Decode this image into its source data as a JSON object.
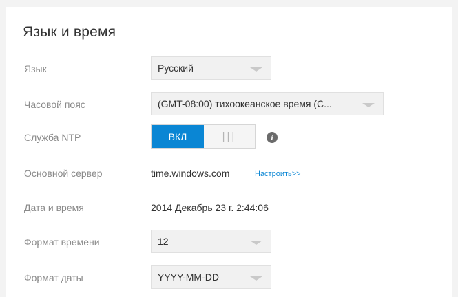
{
  "section": {
    "title": "Язык и время"
  },
  "rows": {
    "language": {
      "label": "Язык",
      "value": "Русский"
    },
    "timezone": {
      "label": "Часовой пояс",
      "value": "(GMT-08:00) тихоокеанское время (С..."
    },
    "ntp": {
      "label": "Служба NTP",
      "toggle_on": "ВКЛ",
      "toggle_grip": "|||"
    },
    "server": {
      "label": "Основной сервер",
      "value": "time.windows.com",
      "link": "Настроить>>"
    },
    "datetime": {
      "label": "Дата и время",
      "value": "2014 Декабрь 23 г. 2:44:06"
    },
    "time_format": {
      "label": "Формат времени",
      "value": "12"
    },
    "date_format": {
      "label": "Формат даты",
      "value": "YYYY-MM-DD"
    }
  },
  "colors": {
    "accent": "#0a86d4",
    "label": "#8a8a8a",
    "background": "#f3f3f3"
  },
  "icons": {
    "info": "info-icon",
    "dropdown": "chevron-down-icon"
  }
}
